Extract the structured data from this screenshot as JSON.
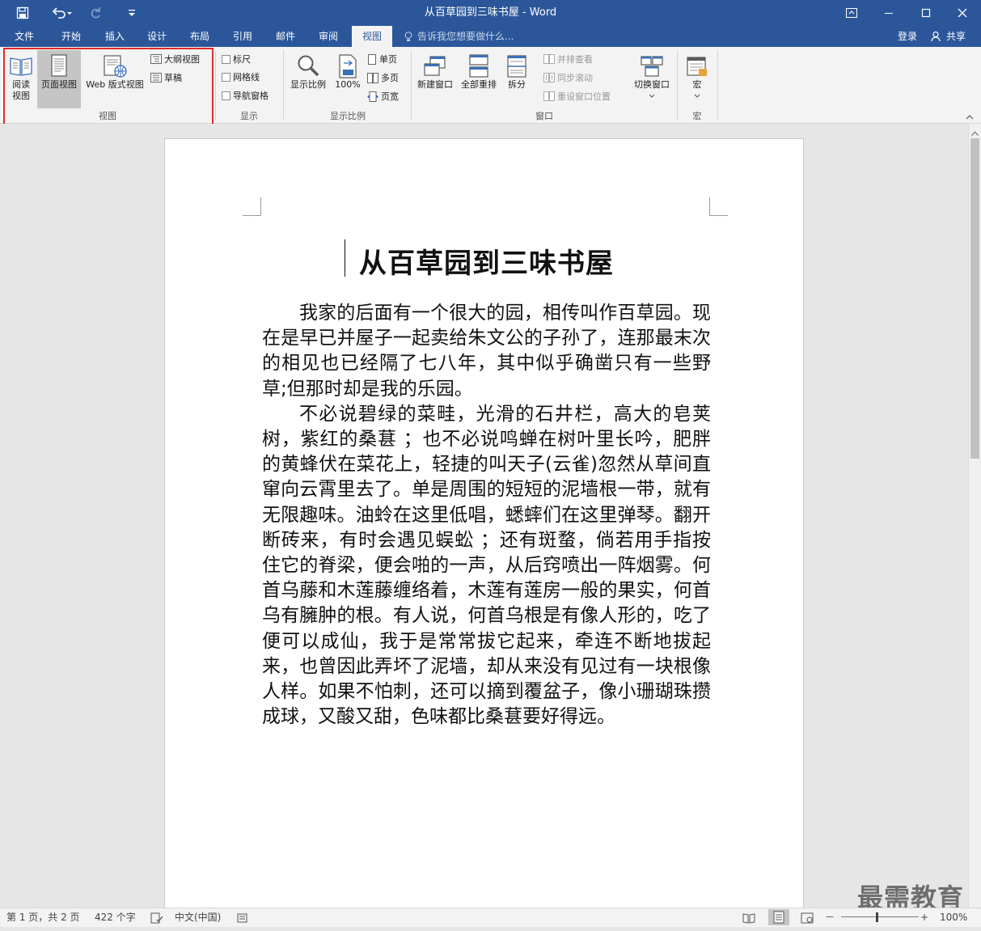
{
  "window": {
    "title": "从百草园到三味书屋 - Word",
    "restore_icon": "ribbon-display-options-icon",
    "minimize_icon": "minimize-icon",
    "maximize_icon": "maximize-icon",
    "close_icon": "close-icon"
  },
  "quick_access": {
    "save_icon": "save-icon",
    "undo_icon": "undo-icon",
    "redo_icon": "redo-icon",
    "customize_icon": "customize-icon"
  },
  "tabs": [
    {
      "label": "文件"
    },
    {
      "label": "开始"
    },
    {
      "label": "插入"
    },
    {
      "label": "设计"
    },
    {
      "label": "布局"
    },
    {
      "label": "引用"
    },
    {
      "label": "邮件"
    },
    {
      "label": "审阅"
    },
    {
      "label": "视图"
    }
  ],
  "active_tab": "视图",
  "tell_me": "告诉我您想要做什么...",
  "login": "登录",
  "share": "共享",
  "ribbon": {
    "views": {
      "label": "视图",
      "read_mode": "阅读\n视图",
      "read_line1": "阅读",
      "read_line2": "视图",
      "print_layout": "页面视图",
      "web_layout": "Web 版式视图",
      "outline": "大纲视图",
      "draft": "草稿"
    },
    "show": {
      "label": "显示",
      "ruler": "标尺",
      "gridlines": "网格线",
      "nav_pane": "导航窗格"
    },
    "zoom": {
      "label": "显示比例",
      "zoom_btn": "显示比例",
      "hundred": "100%",
      "one_page": "单页",
      "multi_page": "多页",
      "page_width": "页宽"
    },
    "window": {
      "label": "窗口",
      "new_window": "新建窗口",
      "arrange_all": "全部重排",
      "split": "拆分",
      "side_by_side": "并排查看",
      "sync_scroll": "同步滚动",
      "reset_pos": "重设窗口位置",
      "switch_windows": "切换窗口"
    },
    "macros": {
      "label": "宏",
      "macros_btn": "宏"
    }
  },
  "document": {
    "title": "从百草园到三味书屋",
    "paragraphs": [
      "我家的后面有一个很大的园，相传叫作百草园。现在是早已并屋子一起卖给朱文公的子孙了，连那最末次的相见也已经隔了七八年，其中似乎确凿只有一些野草;但那时却是我的乐园。",
      "不必说碧绿的菜畦，光滑的石井栏，高大的皂荚树，紫红的桑葚 ；也不必说鸣蝉在树叶里长吟，肥胖的黄蜂伏在菜花上，轻捷的叫天子(云雀)忽然从草间直窜向云霄里去了。单是周围的短短的泥墙根一带，就有无限趣味。油蛉在这里低唱，蟋蟀们在这里弹琴。翻开断砖来，有时会遇见蜈蚣 ；还有斑蝥，倘若用手指按住它的脊梁，便会啪的一声，从后窍喷出一阵烟雾。何首乌藤和木莲藤缠络着，木莲有莲房一般的果实，何首乌有臃肿的根。有人说，何首乌根是有像人形的，吃了便可以成仙，我于是常常拔它起来，牵连不断地拔起来，也曾因此弄坏了泥墙，却从来没有见过有一块根像人样。如果不怕刺，还可以摘到覆盆子，像小珊瑚珠攒成球，又酸又甜，色味都比桑葚要好得远。"
    ]
  },
  "status_bar": {
    "page": "第 1 页，共 2 页",
    "words": "422 个字",
    "language": "中文(中国)",
    "zoom": "100%"
  },
  "watermark": "最需教育"
}
